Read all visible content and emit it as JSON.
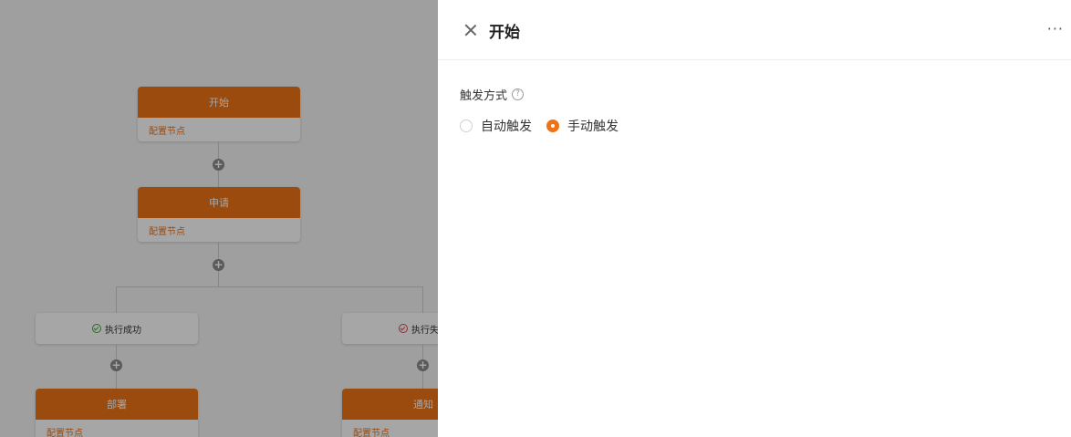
{
  "canvas": {
    "nodes": [
      {
        "title": "开始",
        "config": "配置节点"
      },
      {
        "title": "申请",
        "config": "配置节点"
      },
      {
        "title": "部署",
        "config": "配置节点"
      },
      {
        "title": "通知",
        "config": "配置节点"
      }
    ],
    "branches": [
      {
        "label": "执行成功",
        "status": "success"
      },
      {
        "label": "执行失败",
        "status": "failure"
      }
    ]
  },
  "drawer": {
    "title": "开始",
    "more": "···",
    "trigger": {
      "label": "触发方式",
      "help": "?",
      "options": [
        {
          "label": "自动触发",
          "checked": false
        },
        {
          "label": "手动触发",
          "checked": true
        }
      ]
    }
  },
  "colors": {
    "accent": "#ef7316",
    "success": "#3aaa35",
    "failure": "#e0424e"
  }
}
